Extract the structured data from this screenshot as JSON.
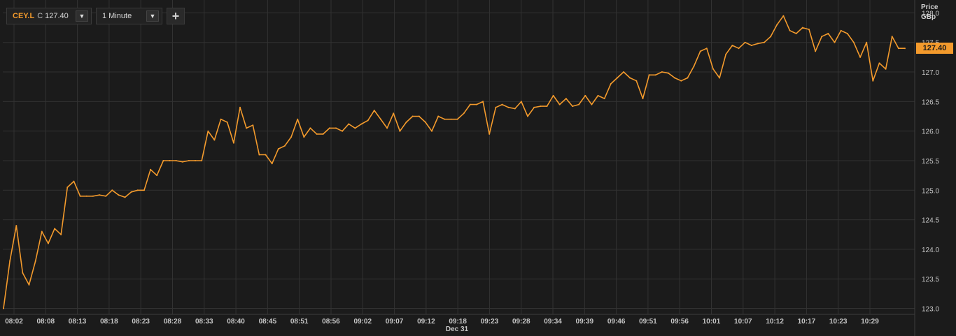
{
  "toolbar": {
    "symbol": "CEY.L",
    "close_prefix": "C",
    "close_value": "127.40",
    "dropdown_arrow": "▼",
    "interval": "1 Minute",
    "add_button": "+"
  },
  "axis": {
    "price_title": "Price",
    "currency": "GBp"
  },
  "last_price_badge": "127.40",
  "colors": {
    "background": "#1b1b1b",
    "line": "#f39a2c",
    "grid": "#333333"
  },
  "chart_data": {
    "type": "line",
    "title": "",
    "xlabel": "",
    "ylabel": "Price GBp",
    "ylim": [
      122.9,
      128.2
    ],
    "y_ticks": [
      123.0,
      123.5,
      124.0,
      124.5,
      125.0,
      125.5,
      126.0,
      126.5,
      127.0,
      127.5,
      128.0
    ],
    "y_tick_labels": [
      "123.0",
      "123.5",
      "124.0",
      "124.5",
      "125.0",
      "125.5",
      "126.0",
      "126.5",
      "127.0",
      "127.5",
      "128.0"
    ],
    "x_ticks": [
      "08:02",
      "08:08",
      "08:13",
      "08:18",
      "08:23",
      "08:28",
      "08:33",
      "08:40",
      "08:45",
      "08:51",
      "08:56",
      "09:02",
      "09:07",
      "09:12",
      "09:18",
      "09:23",
      "09:28",
      "09:34",
      "09:39",
      "09:46",
      "09:51",
      "09:56",
      "10:01",
      "10:07",
      "10:12",
      "10:17",
      "10:23",
      "10:29"
    ],
    "date_label": "Dec 31",
    "grid": true,
    "series": [
      {
        "values": [
          123.0,
          123.8,
          124.4,
          123.6,
          123.4,
          123.8,
          124.3,
          124.1,
          124.35,
          124.25,
          125.05,
          125.15,
          124.9,
          124.9,
          124.9,
          124.92,
          124.9,
          125.0,
          124.92,
          124.88,
          124.97,
          125.0,
          125.0,
          125.35,
          125.25,
          125.5,
          125.5,
          125.5,
          125.48,
          125.5,
          125.5,
          125.5,
          126.0,
          125.85,
          126.2,
          126.15,
          125.8,
          126.4,
          126.05,
          126.1,
          125.6,
          125.6,
          125.45,
          125.7,
          125.75,
          125.9,
          126.2,
          125.9,
          126.05,
          125.95,
          125.95,
          126.05,
          126.05,
          126.0,
          126.12,
          126.05,
          126.12,
          126.18,
          126.35,
          126.2,
          126.05,
          126.3,
          126.0,
          126.15,
          126.25,
          126.25,
          126.15,
          126.0,
          126.25,
          126.2,
          126.2,
          126.2,
          126.3,
          126.45,
          126.45,
          126.5,
          125.95,
          126.4,
          126.45,
          126.4,
          126.38,
          126.5,
          126.25,
          126.4,
          126.42,
          126.42,
          126.6,
          126.45,
          126.55,
          126.42,
          126.45,
          126.6,
          126.45,
          126.6,
          126.55,
          126.8,
          126.9,
          127.0,
          126.9,
          126.85,
          126.55,
          126.95,
          126.95,
          127.0,
          126.98,
          126.9,
          126.85,
          126.9,
          127.1,
          127.35,
          127.4,
          127.05,
          126.9,
          127.3,
          127.45,
          127.4,
          127.5,
          127.45,
          127.48,
          127.5,
          127.6,
          127.8,
          127.95,
          127.7,
          127.65,
          127.75,
          127.72,
          127.35,
          127.6,
          127.65,
          127.5,
          127.7,
          127.65,
          127.5,
          127.25,
          127.5,
          126.85,
          127.15,
          127.05,
          127.6,
          127.4,
          127.4
        ]
      }
    ]
  }
}
